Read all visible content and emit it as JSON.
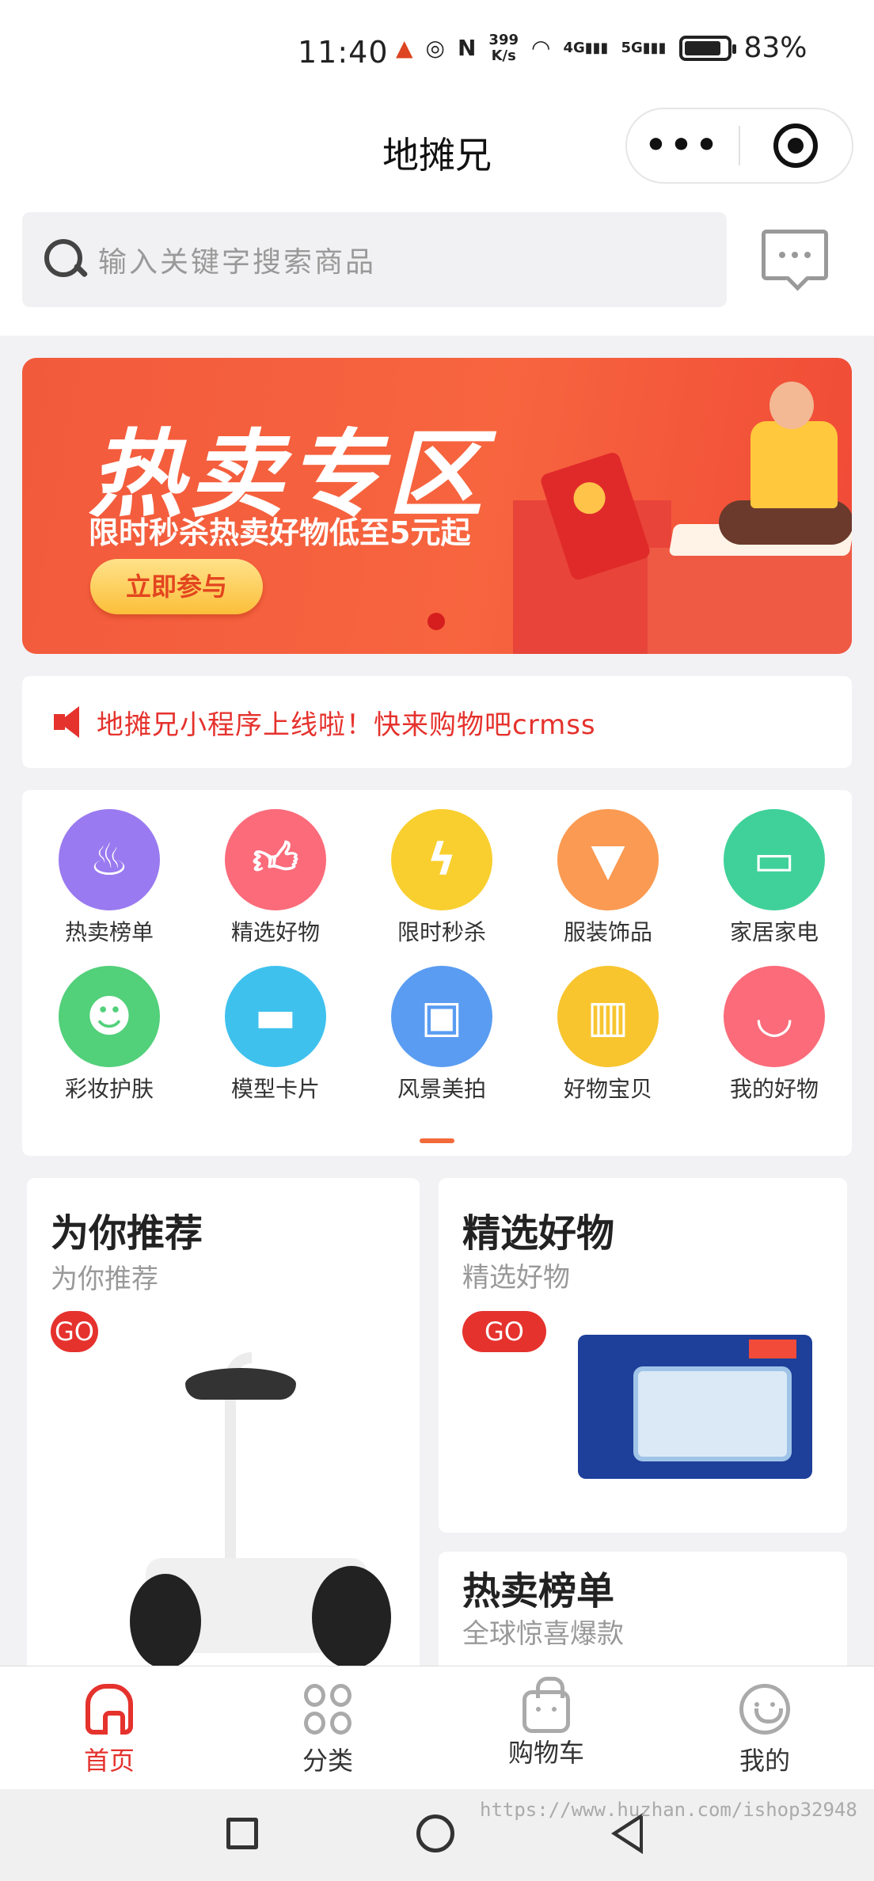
{
  "status_bar": {
    "time": "11:40",
    "net_speed_value": "399",
    "net_speed_unit": "K/s",
    "signal_1": "4G",
    "signal_2": "5G",
    "battery_percent": "83%",
    "battery_level": 0.83
  },
  "navbar": {
    "title": "地摊兄",
    "more_icon": "more-dots-icon",
    "close_icon": "target-circle-icon"
  },
  "search": {
    "placeholder": "输入关键字搜索商品",
    "icon": "search-icon",
    "message_icon": "message-icon"
  },
  "banner": {
    "title": "热卖专区",
    "subtitle": "限时秒杀热卖好物低至5元起",
    "button": "立即参与",
    "active_dot": 1
  },
  "notice": {
    "icon": "speaker-icon",
    "text": "地摊兄小程序上线啦！快来购物吧crmss"
  },
  "categories": [
    {
      "label": "热卖榜单",
      "icon": "fire-icon",
      "color": "#9a7af0"
    },
    {
      "label": "精选好物",
      "icon": "thumbs-up-icon",
      "color": "#fb6b7a"
    },
    {
      "label": "限时秒杀",
      "icon": "lightning-icon",
      "color": "#f9cf2f"
    },
    {
      "label": "服装饰品",
      "icon": "shirt-icon",
      "color": "#fb9a52"
    },
    {
      "label": "家居家电",
      "icon": "sofa-icon",
      "color": "#3fd199"
    },
    {
      "label": "彩妆护肤",
      "icon": "face-mask-icon",
      "color": "#52d07a"
    },
    {
      "label": "模型卡片",
      "icon": "card-icon",
      "color": "#3fc1ee"
    },
    {
      "label": "风景美拍",
      "icon": "picture-icon",
      "color": "#5a9cf2"
    },
    {
      "label": "好物宝贝",
      "icon": "gift-icon",
      "color": "#f8c52f"
    },
    {
      "label": "我的好物",
      "icon": "shopping-bag-icon",
      "color": "#fb6b7a"
    }
  ],
  "cards": {
    "recommend": {
      "title": "为你推荐",
      "subtitle": "为你推荐",
      "go": "GO"
    },
    "selected": {
      "title": "精选好物",
      "subtitle": "精选好物",
      "go": "GO"
    },
    "hot": {
      "title": "热卖榜单",
      "subtitle": "全球惊喜爆款"
    }
  },
  "tabbar": [
    {
      "label": "首页",
      "icon": "home-icon",
      "active": true
    },
    {
      "label": "分类",
      "icon": "category-grid-icon",
      "active": false
    },
    {
      "label": "购物车",
      "icon": "cart-icon",
      "active": false
    },
    {
      "label": "我的",
      "icon": "smile-profile-icon",
      "active": false
    }
  ],
  "watermark": "https://www.huzhan.com/ishop32948",
  "colors": {
    "accent": "#e5322d",
    "banner": "#f25a3c",
    "background": "#f2f2f4"
  }
}
